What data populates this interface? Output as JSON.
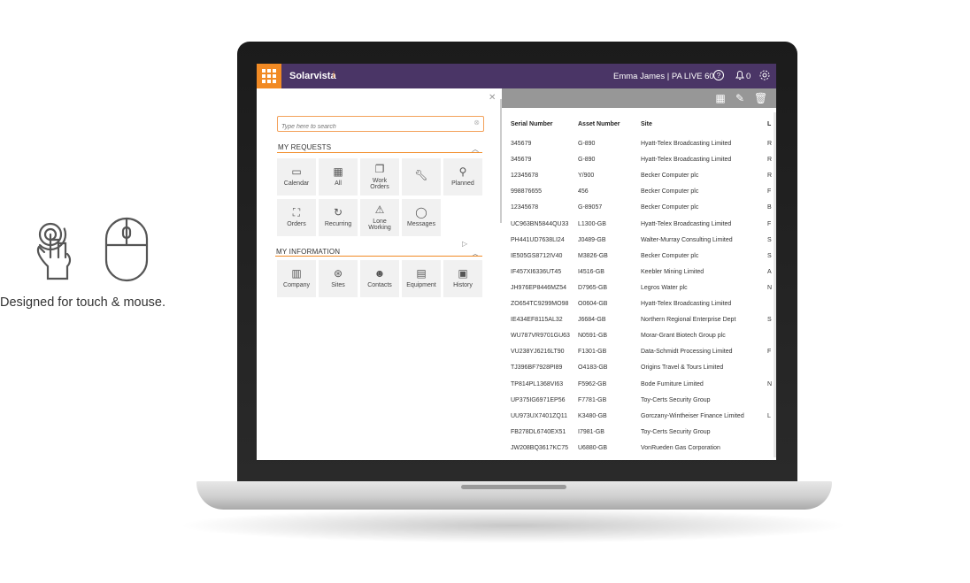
{
  "promo": {
    "tagline": "Designed for touch & mouse.",
    "icons": [
      "touch-hand-icon",
      "mouse-icon"
    ]
  },
  "app": {
    "brand": "Solarvista",
    "brand_suffix": "i",
    "user_label": "Emma James | PA LIVE 60",
    "notification_count": "0",
    "colors": {
      "header": "#4a3566",
      "accent": "#f18a24",
      "toolbar": "#979797",
      "tile": "#f1f1f1"
    }
  },
  "menu": {
    "search_placeholder": "Type here to search",
    "my_requests": {
      "title": "MY REQUESTS",
      "tiles": [
        {
          "label": "Calendar",
          "icon": "calendar-icon"
        },
        {
          "label": "All",
          "icon": "all-grid-icon"
        },
        {
          "label": "Work Orders",
          "icon": "work-orders-icon"
        },
        {
          "label": "",
          "icon": "wrench-icon"
        },
        {
          "label": "Planned",
          "icon": "planned-icon"
        },
        {
          "label": "Orders",
          "icon": "orders-icon"
        },
        {
          "label": "Recurring",
          "icon": "recurring-icon"
        },
        {
          "label": "Lone Working",
          "icon": "warning-icon"
        },
        {
          "label": "Messages",
          "icon": "messages-icon"
        }
      ]
    },
    "my_information": {
      "title": "MY INFORMATION",
      "tiles": [
        {
          "label": "Company",
          "icon": "company-icon"
        },
        {
          "label": "Sites",
          "icon": "sites-icon"
        },
        {
          "label": "Contacts",
          "icon": "contacts-icon"
        },
        {
          "label": "Equipment",
          "icon": "equipment-icon"
        },
        {
          "label": "History",
          "icon": "history-icon"
        }
      ]
    }
  },
  "table": {
    "columns": [
      "Serial Number",
      "Asset Number",
      "Site",
      "L"
    ],
    "rows": [
      [
        "345679",
        "G-890",
        "Hyatt-Telex Broadcasting Limited",
        "R"
      ],
      [
        "345679",
        "G-890",
        "Hyatt-Telex Broadcasting Limited",
        "R"
      ],
      [
        "12345678",
        "Y/900",
        "Becker Computer plc",
        "R"
      ],
      [
        "998876655",
        "456",
        "Becker Computer plc",
        "F"
      ],
      [
        "12345678",
        "G-89057",
        "Becker Computer plc",
        "B"
      ],
      [
        "UC963BN5844QU33",
        "L1300-GB",
        "Hyatt-Telex Broadcasting Limited",
        "F"
      ],
      [
        "PH441UD7638LI24",
        "J0489-GB",
        "Walter-Murray Consulting Limited",
        "S"
      ],
      [
        "IE505GS8712IV40",
        "M3826-GB",
        "Becker Computer plc",
        "S"
      ],
      [
        "IF457XI6336UT45",
        "I4516-GB",
        "Keebler Mining Limited",
        "A"
      ],
      [
        "JH976EP8446MZ54",
        "D7965-GB",
        "Legros Water plc",
        "N"
      ],
      [
        "ZO654TC9299MO98",
        "O0604-GB",
        "Hyatt-Telex Broadcasting Limited",
        ""
      ],
      [
        "IE434EF8115AL32",
        "J6684-GB",
        "Northern Regional Enterprise Dept",
        "S"
      ],
      [
        "WU787VR9701GU63",
        "N0591-GB",
        "Morar-Grant Biotech Group plc",
        ""
      ],
      [
        "VU238YJ6216LT90",
        "F1301-GB",
        "Data-Schmidt Processing Limited",
        "F"
      ],
      [
        "TJ396BF7928PI89",
        "O4183-GB",
        "Origins Travel & Tours Limited",
        ""
      ],
      [
        "TP814PL1368VI63",
        "F5962-GB",
        "Bode Furniture Limited",
        "N"
      ],
      [
        "UP375IG6971EP56",
        "F7781-GB",
        "Toy-Certs Security Group",
        ""
      ],
      [
        "UU973UX7401ZQ11",
        "K3480-GB",
        "Gorczany-Wintheiser Finance Limited",
        "L"
      ],
      [
        "FB278DL6740EX51",
        "I7981-GB",
        "Toy-Certs Security Group",
        ""
      ],
      [
        "JW208BQ3617KC75",
        "U6880-GB",
        "VonRueden Gas Corporation",
        ""
      ]
    ]
  }
}
